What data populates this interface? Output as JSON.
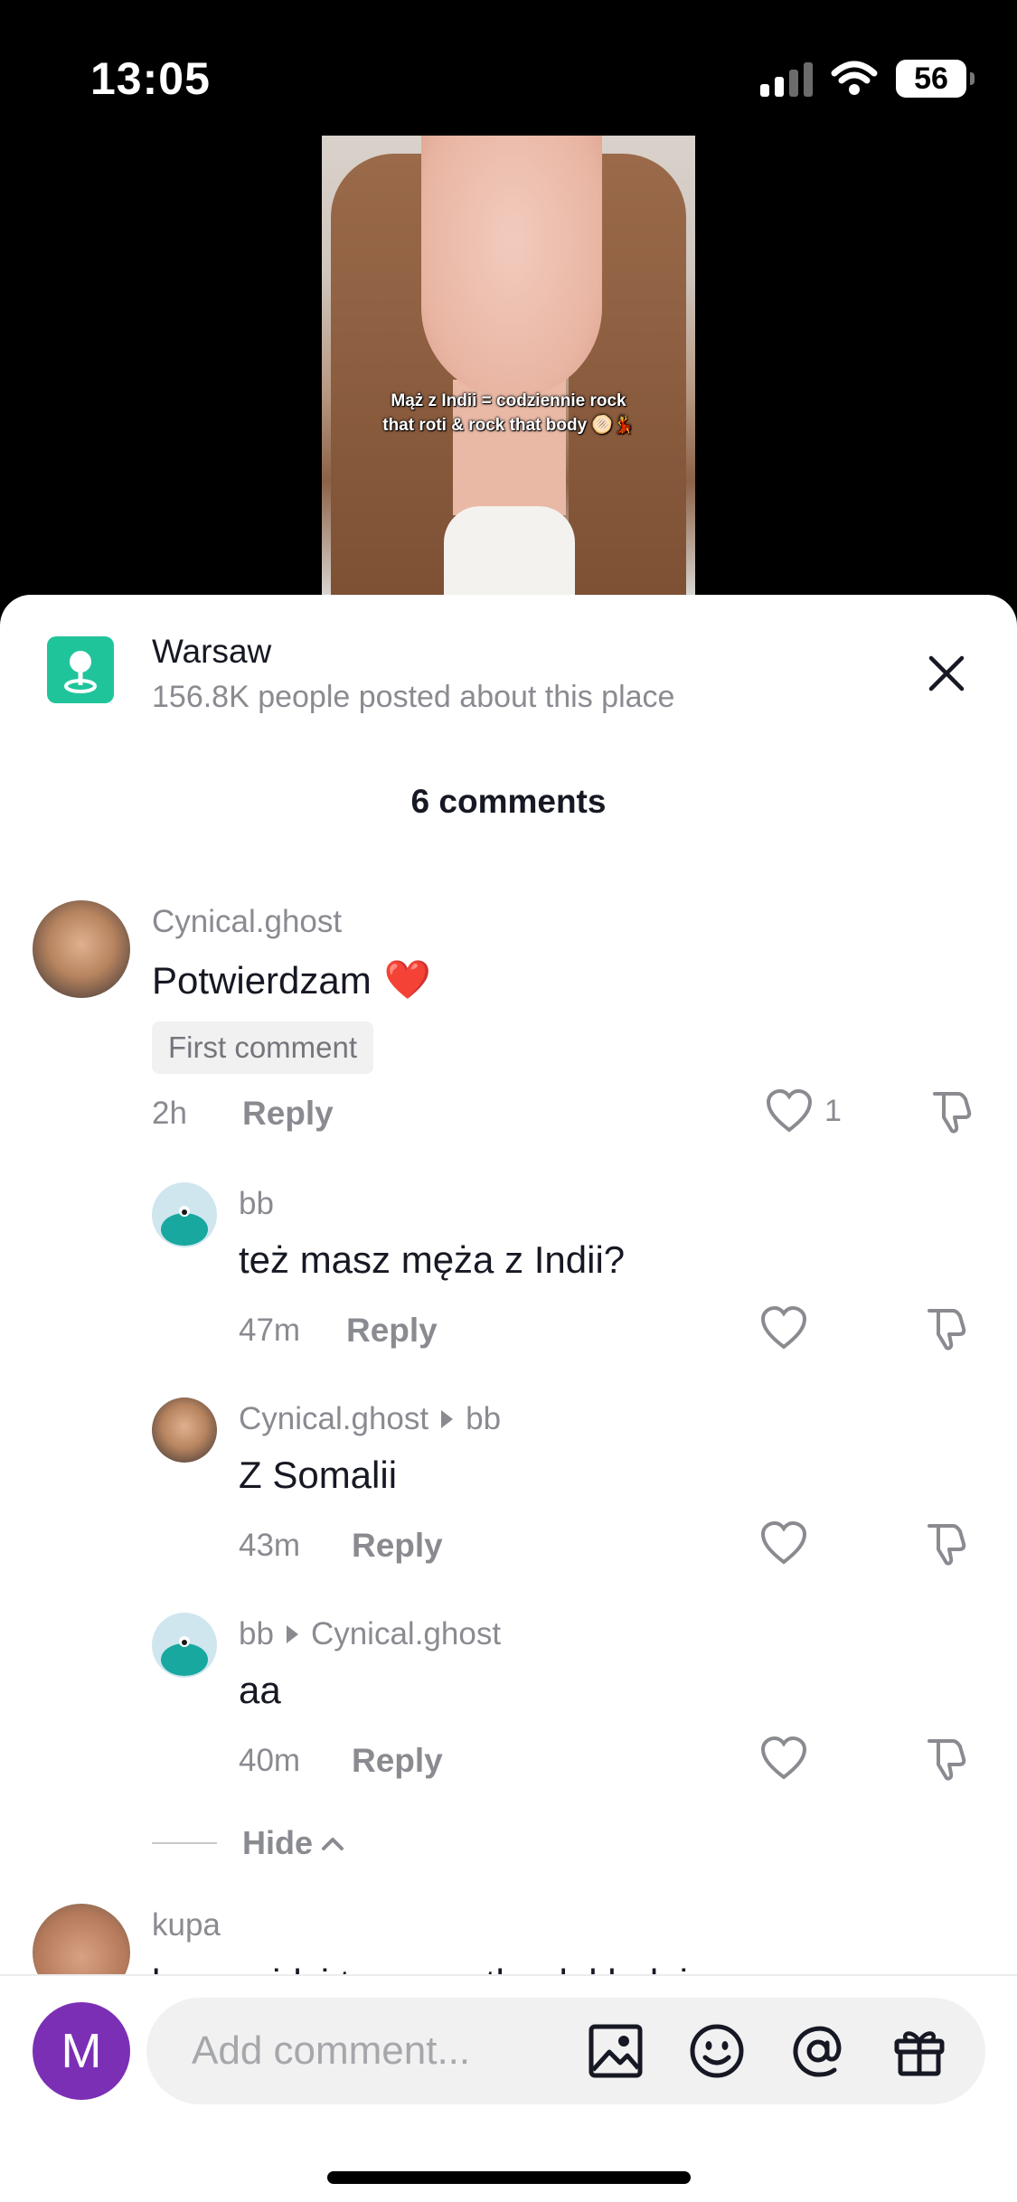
{
  "status_bar": {
    "time": "13:05",
    "battery": "56"
  },
  "video": {
    "caption_line1": "Mąż z Indii = codziennie rock",
    "caption_line2": "that roti & rock that body 🫓💃"
  },
  "sheet": {
    "place": {
      "title": "Warsaw",
      "subtitle": "156.8K people posted about this place"
    },
    "comments_count": "6 comments",
    "comments": [
      {
        "username": "Cynical.ghost",
        "text": "Potwierdzam",
        "emoji": "❤️",
        "badge": "First comment",
        "time": "2h",
        "reply_label": "Reply",
        "like_count": "1"
      }
    ],
    "replies": [
      {
        "username": "bb",
        "text": "też masz męża z Indii?",
        "time": "47m",
        "reply_label": "Reply"
      },
      {
        "username": "Cynical.ghost",
        "reply_to": "bb",
        "text": "Z Somalii",
        "time": "43m",
        "reply_label": "Reply"
      },
      {
        "username": "bb",
        "reply_to": "Cynical.ghost",
        "text": "aa",
        "time": "40m",
        "reply_label": "Reply"
      }
    ],
    "hide_label": "Hide",
    "next_comment": {
      "username": "kupa",
      "text_partial": "kupa widzi to wszystko dokładnie"
    }
  },
  "composer": {
    "avatar_letter": "M",
    "placeholder": "Add comment..."
  },
  "icons": {
    "place": "map-pin-icon",
    "close": "close-icon",
    "like": "heart-outline-icon",
    "dislike": "thumbs-down-icon",
    "image": "image-icon",
    "emoji": "smiley-icon",
    "mention": "at-icon",
    "gift": "gift-icon"
  },
  "colors": {
    "place_icon_bg": "#20c49b",
    "user_avatar_bg": "#7b2fb5"
  }
}
